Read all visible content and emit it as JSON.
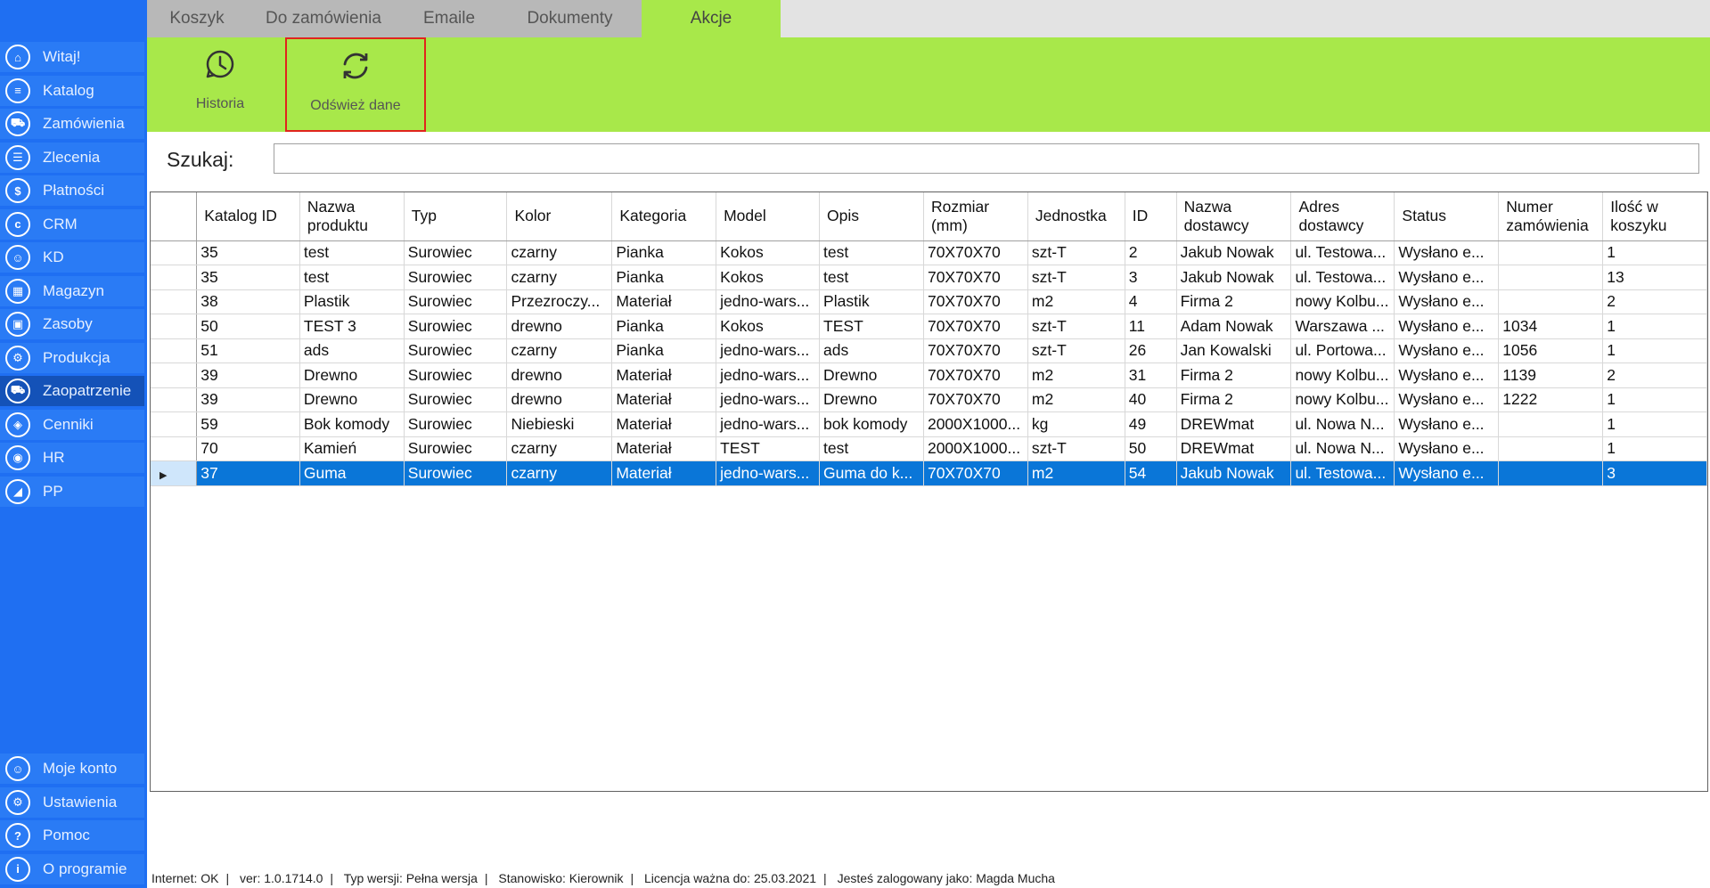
{
  "sidebar": {
    "items": [
      {
        "label": "Witaj!",
        "icon": "home-icon",
        "glyph": "⌂"
      },
      {
        "label": "Katalog",
        "icon": "book-icon",
        "glyph": "≡"
      },
      {
        "label": "Zamówienia",
        "icon": "cart-icon",
        "glyph": "⛟"
      },
      {
        "label": "Zlecenia",
        "icon": "list-icon",
        "glyph": "☰"
      },
      {
        "label": "Płatności",
        "icon": "dollar-icon",
        "glyph": "$"
      },
      {
        "label": "CRM",
        "icon": "crm-icon",
        "glyph": "c"
      },
      {
        "label": "KD",
        "icon": "person-icon",
        "glyph": "☺"
      },
      {
        "label": "Magazyn",
        "icon": "warehouse-icon",
        "glyph": "▦"
      },
      {
        "label": "Zasoby",
        "icon": "resources-icon",
        "glyph": "▣"
      },
      {
        "label": "Produkcja",
        "icon": "production-icon",
        "glyph": "⚙"
      },
      {
        "label": "Zaopatrzenie",
        "icon": "truck-icon",
        "glyph": "⛟"
      },
      {
        "label": "Cenniki",
        "icon": "tag-icon",
        "glyph": "◈"
      },
      {
        "label": "HR",
        "icon": "hr-icon",
        "glyph": "◉"
      },
      {
        "label": "PP",
        "icon": "chart-icon",
        "glyph": "◢"
      }
    ],
    "bottom_items": [
      {
        "label": "Moje konto",
        "icon": "account-icon",
        "glyph": "☺"
      },
      {
        "label": "Ustawienia",
        "icon": "settings-icon",
        "glyph": "⚙"
      },
      {
        "label": "Pomoc",
        "icon": "help-icon",
        "glyph": "?"
      },
      {
        "label": "O programie",
        "icon": "info-icon",
        "glyph": "i"
      }
    ],
    "active": "Zaopatrzenie"
  },
  "tabs": [
    "Koszyk",
    "Do zamówienia",
    "Emaile",
    "Dokumenty",
    "Akcje"
  ],
  "active_tab": "Akcje",
  "ribbon": {
    "history_label": "Historia",
    "refresh_label": "Odśwież dane"
  },
  "search": {
    "label": "Szukaj:",
    "value": ""
  },
  "grid": {
    "columns": [
      "Katalog ID",
      "Nazwa produktu",
      "Typ",
      "Kolor",
      "Kategoria",
      "Model",
      "Opis",
      "Rozmiar (mm)",
      "Jednostka",
      "ID",
      "Nazwa dostawcy",
      "Adres dostawcy",
      "Status",
      "Numer zamówienia",
      "Ilość w koszyku"
    ],
    "rows": [
      [
        "35",
        "test",
        "Surowiec",
        "czarny",
        "Pianka",
        "Kokos",
        "test",
        "70X70X70",
        "szt-T",
        "2",
        "Jakub Nowak",
        "ul. Testowa...",
        "Wysłano e...",
        "",
        "1"
      ],
      [
        "35",
        "test",
        "Surowiec",
        "czarny",
        "Pianka",
        "Kokos",
        "test",
        "70X70X70",
        "szt-T",
        "3",
        "Jakub Nowak",
        "ul. Testowa...",
        "Wysłano e...",
        "",
        "13"
      ],
      [
        "38",
        "Plastik",
        "Surowiec",
        "Przezroczy...",
        "Materiał",
        "jedno-wars...",
        "Plastik",
        "70X70X70",
        "m2",
        "4",
        "Firma 2",
        "nowy Kolbu...",
        "Wysłano e...",
        "",
        "2"
      ],
      [
        "50",
        "TEST 3",
        "Surowiec",
        "drewno",
        "Pianka",
        "Kokos",
        "TEST",
        "70X70X70",
        "szt-T",
        "11",
        "Adam Nowak",
        "Warszawa ...",
        "Wysłano e...",
        "1034",
        "1"
      ],
      [
        "51",
        "ads",
        "Surowiec",
        "czarny",
        "Pianka",
        "jedno-wars...",
        "ads",
        "70X70X70",
        "szt-T",
        "26",
        "Jan Kowalski",
        "ul. Portowa...",
        "Wysłano e...",
        "1056",
        "1"
      ],
      [
        "39",
        "Drewno",
        "Surowiec",
        "drewno",
        "Materiał",
        "jedno-wars...",
        "Drewno",
        "70X70X70",
        "m2",
        "31",
        "Firma 2",
        "nowy Kolbu...",
        "Wysłano e...",
        "1139",
        "2"
      ],
      [
        "39",
        "Drewno",
        "Surowiec",
        "drewno",
        "Materiał",
        "jedno-wars...",
        "Drewno",
        "70X70X70",
        "m2",
        "40",
        "Firma 2",
        "nowy Kolbu...",
        "Wysłano e...",
        "1222",
        "1"
      ],
      [
        "59",
        "Bok komody",
        "Surowiec",
        "Niebieski",
        "Materiał",
        "jedno-wars...",
        "bok komody",
        "2000X1000...",
        "kg",
        "49",
        "DREWmat",
        "ul. Nowa N...",
        "Wysłano e...",
        "",
        "1"
      ],
      [
        "70",
        "Kamień",
        "Surowiec",
        "czarny",
        "Materiał",
        "TEST",
        "test",
        "2000X1000...",
        "szt-T",
        "50",
        "DREWmat",
        "ul. Nowa N...",
        "Wysłano e...",
        "",
        "1"
      ],
      [
        "37",
        "Guma",
        "Surowiec",
        "czarny",
        "Materiał",
        "jedno-wars...",
        "Guma do k...",
        "70X70X70",
        "m2",
        "54",
        "Jakub Nowak",
        "ul. Testowa...",
        "Wysłano e...",
        "",
        "3"
      ]
    ],
    "selected_row_index": 9
  },
  "statusbar": {
    "internet": "Internet: OK",
    "version": "ver: 1.0.1714.0",
    "version_type": "Typ wersji: Pełna wersja",
    "station": "Stanowisko: Kierownik",
    "license": "Licencja ważna do: 25.03.2021",
    "user": "Jesteś zalogowany jako: Magda Mucha"
  },
  "colors": {
    "sidebar_bg": "#1f6ff2",
    "accent_green": "#a8e84a",
    "selection_blue": "#0a76d8",
    "highlight_red": "#e0241c"
  }
}
